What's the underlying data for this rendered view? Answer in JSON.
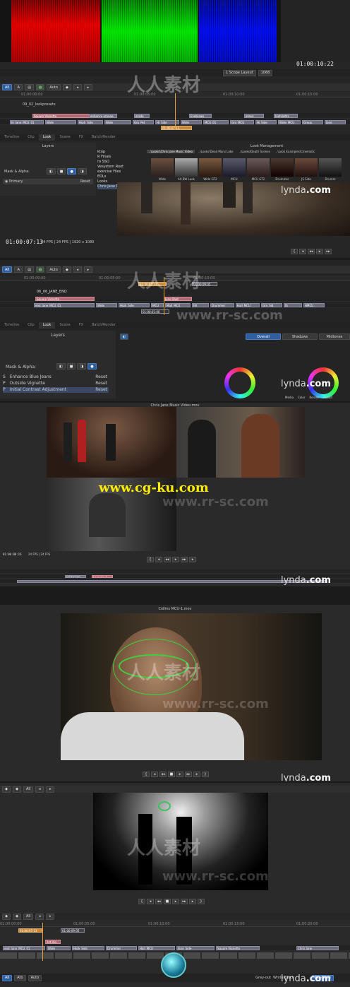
{
  "section1": {
    "scope_time": "01:00:10:22",
    "scope_layout": "1 Scope Layout",
    "scope_size": "1068",
    "tool_all": "All",
    "tool_auto": "Auto",
    "ruler_marks": [
      "01:00:00:00",
      "01:00:05:00",
      "01:00:10:00",
      "01:00:15:00"
    ],
    "sequence_name": "09_02_lookpresets",
    "clips_row1": [
      "Square Vignette",
      "enhance orange",
      "grade",
      "Eyebrows",
      "green",
      "highlights"
    ],
    "clips_row2": [
      "hi_Jane_MCU_01",
      "",
      "Wide",
      "High_Side",
      "Wide",
      "Gro_Pet",
      "Hi_Side",
      "Wide",
      "MCU_01",
      "Gro_MCU",
      "Hi_Side",
      "Wide_MCU",
      "Group",
      "Jane"
    ],
    "playhead_tc": "01:00:07:13",
    "tabs": [
      "Timeline",
      "Clip",
      "Look",
      "Scene",
      "FX",
      "Batch/Render"
    ],
    "layers_title": "Layers",
    "mask_alpha": "Mask & Alpha:",
    "layer_primary": "Primary",
    "layer_reset": "Reset",
    "look_mgmt": "Look Management",
    "folders": [
      "ktop",
      "R Finals",
      "ro SSD",
      "Vesystem Root",
      "exercise Files",
      "EDLs",
      "Looks",
      "Chris Jane Music Video"
    ],
    "look_tabs": [
      "..\\Looks\\Chris Jane Music Video",
      "..\\Looks\\Dead Mans Lake",
      "..\\Looks\\Death Scenes",
      "..\\Look Examples\\Cinematic"
    ],
    "thumb_labels": [
      "Wide",
      "Alt BW Look",
      "Wide GT2",
      "MCU",
      "MCU GT2",
      "Drummer",
      "JS Side",
      "Drumm"
    ],
    "viewer_tc": "01:00:07:13",
    "viewer_info": "24 FPS | 24 FPS | 1920 x 1080"
  },
  "section2": {
    "tool_all": "All",
    "tool_auto": "Auto",
    "ruler_marks": [
      "01:00:00:00",
      "01:00:05:00",
      "01:00:10:00"
    ],
    "sequence_name": "06_06_JANE_END",
    "playhead_tc": "01:00:07:13",
    "end_tc": "01:00:09:05",
    "clips_row1": [
      "Square Vignette",
      "Jane Shot"
    ],
    "clips_row2": [
      "end_Jane_MCU_01",
      "Wide",
      "High_Side",
      "MCU",
      "Mall_MCU",
      "Fill",
      "Drummer",
      "Hall_MCU",
      "Gro_Sid",
      "JS",
      "HMCU"
    ],
    "small_tc": "01:00:01:00",
    "tabs": [
      "Timeline",
      "Clip",
      "Look",
      "Scene",
      "FX",
      "Batch/Render"
    ],
    "layers_title": "Layers",
    "mask_alpha": "Mask & Alpha:",
    "layers": [
      {
        "type": "S",
        "name": "Enhance Blue Jeans",
        "reset": "Reset"
      },
      {
        "type": "P",
        "name": "Outside Vignette",
        "reset": "Reset"
      },
      {
        "type": "P",
        "name": "Initial Contrast Adjustment",
        "reset": "Reset"
      }
    ],
    "cc_tabs": [
      "Overall",
      "Shadows",
      "Midtones"
    ],
    "cc_sub_tabs": [
      "Media",
      "Color",
      "Render",
      "Result"
    ]
  },
  "section3": {
    "viewer_title": "Chris Jane Music Video.mov",
    "tc": "01:00:08:16",
    "info": "24 FPS | 24 FPS",
    "clip_label": "MONSTER",
    "clip_label2": "Lorenzo_3"
  },
  "section4": {
    "viewer_title": "Collins MCU-1.mov"
  },
  "section5": {
    "tool_all": "All",
    "ruler_marks": [
      "01:00:00:00",
      "01:00:05:00",
      "01:00:10:00",
      "01:00:15:00",
      "01:00:20:00"
    ],
    "tc_a": "01:00:07:13",
    "tc_b": "01:00:09:05",
    "clip_label": "1st Vig",
    "clips_row": [
      "end_Jane_MCU_01",
      "Wide",
      "High_Side",
      "Drummer",
      "Hall_MCU",
      "Jane_Side",
      "Square Vignette",
      "Chris Jane"
    ],
    "bottom_labels": [
      "Grey-out",
      "White/Black"
    ],
    "bottom_tab": "Exposure",
    "bottom_left": [
      "All",
      "Ato",
      "Auto"
    ]
  },
  "watermarks": {
    "cn": "人人素材",
    "rr": "www.rr-sc.com",
    "cg": "www.cg-ku.com",
    "lynda": "lynda",
    "lynda_dot": ".com"
  },
  "colors": {
    "accent_blue": "#2f5f9e",
    "clip_gray": "#6a6b7c",
    "clip_pink": "#b06a76",
    "playhead": "#e0a030",
    "cg_yellow": "#ffee00"
  }
}
